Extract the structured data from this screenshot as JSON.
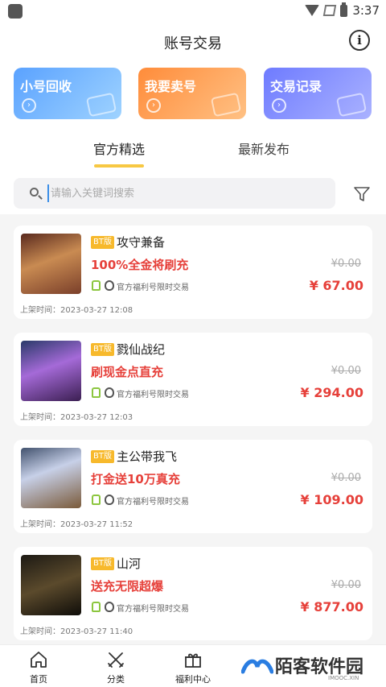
{
  "status": {
    "time": "3:37"
  },
  "header": {
    "title": "账号交易",
    "info_icon": "i"
  },
  "cards": [
    {
      "label": "小号回收",
      "color": "#5aa2ff"
    },
    {
      "label": "我要卖号",
      "color": "#ff8c3a"
    },
    {
      "label": "交易记录",
      "color": "#6e7bff"
    }
  ],
  "tabs": [
    {
      "label": "官方精选",
      "active": true
    },
    {
      "label": "最新发布",
      "active": false
    }
  ],
  "search": {
    "placeholder": "请输入关键词搜索"
  },
  "badge_label": "BT版",
  "items": [
    {
      "name": "攻守兼备",
      "promo": "100%全金将刷充",
      "tag": "官方福利号限时交易",
      "old_price": "¥0.00",
      "price": "¥ 67.00",
      "time": "上架时间：2023-03-27 12:08"
    },
    {
      "name": "戮仙战纪",
      "promo": "刷现金点直充",
      "tag": "官方福利号限时交易",
      "old_price": "¥0.00",
      "price": "¥ 294.00",
      "time": "上架时间：2023-03-27 12:03"
    },
    {
      "name": "主公带我飞",
      "promo": "打金送10万真充",
      "tag": "官方福利号限时交易",
      "old_price": "¥0.00",
      "price": "¥ 109.00",
      "time": "上架时间：2023-03-27 11:52"
    },
    {
      "name": "山河",
      "promo": "送充无限超爆",
      "tag": "官方福利号限时交易",
      "old_price": "¥0.00",
      "price": "¥ 877.00",
      "time": "上架时间：2023-03-27 11:40"
    }
  ],
  "nav": [
    {
      "label": "首页",
      "icon": "home-icon"
    },
    {
      "label": "分类",
      "icon": "crossed-swords-icon"
    },
    {
      "label": "福利中心",
      "icon": "gift-icon"
    }
  ],
  "watermark": {
    "text": "陌客软件园",
    "sub": "IMOOC.XIN"
  },
  "colors": {
    "accent": "#f7c843",
    "price": "#e6403a",
    "badge": "#f7b92c"
  }
}
